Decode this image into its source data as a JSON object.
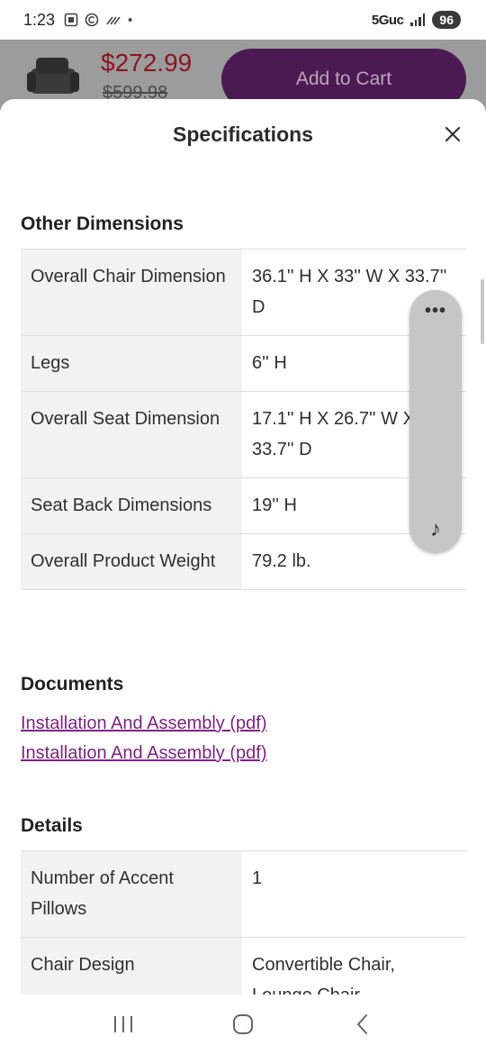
{
  "status_bar": {
    "time": "1:23",
    "network": "5Guc",
    "battery": "96",
    "dot": "•"
  },
  "product": {
    "price": "$272.99",
    "old_price": "$599.98",
    "add_to_cart": "Add to Cart"
  },
  "sheet": {
    "title": "Specifications"
  },
  "other_dimensions": {
    "title": "Other Dimensions",
    "rows": [
      {
        "label": "Overall Chair Dimension",
        "value": "36.1'' H X 33'' W X 33.7'' D"
      },
      {
        "label": "Legs",
        "value": "6'' H"
      },
      {
        "label": "Overall Seat Dimension",
        "value": "17.1'' H X 26.7'' W X 33.7'' D"
      },
      {
        "label": "Seat Back Dimensions",
        "value": "19'' H"
      },
      {
        "label": "Overall Product Weight",
        "value": "79.2 lb."
      }
    ]
  },
  "documents": {
    "title": "Documents",
    "links": [
      "Installation And Assembly (pdf)",
      "Installation And Assembly (pdf)"
    ]
  },
  "details": {
    "title": "Details",
    "rows": [
      {
        "label": "Number of Accent Pillows",
        "value": "1"
      },
      {
        "label": "Chair Design",
        "value": "Convertible Chair, Lounge Chair"
      }
    ]
  },
  "float_widget": {
    "more": "•••",
    "note": "♪"
  },
  "icons": {
    "close": "close-icon",
    "recents": "recents-icon",
    "home": "home-icon",
    "back": "back-icon"
  },
  "colors": {
    "price": "#8a1624",
    "add_to_cart_bg": "#4c1a52",
    "link": "#7b2481",
    "table_key_bg": "#f2f2f2"
  }
}
